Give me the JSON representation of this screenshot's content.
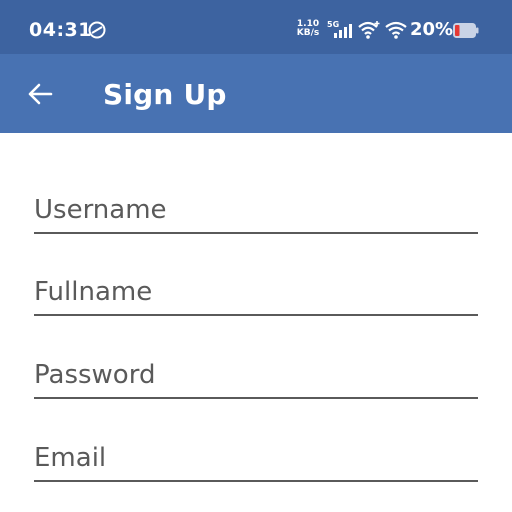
{
  "status_bar": {
    "time": "04:31",
    "net_speed_value": "1.10",
    "net_speed_unit": "KB/s",
    "network_type": "5G",
    "battery_percent": "20%",
    "battery_color": "#e53935"
  },
  "app_bar": {
    "title": "Sign Up",
    "background": "#4872b2"
  },
  "form": {
    "fields": [
      {
        "placeholder": "Username",
        "value": ""
      },
      {
        "placeholder": "Fullname",
        "value": ""
      },
      {
        "placeholder": "Password",
        "value": ""
      },
      {
        "placeholder": "Email",
        "value": ""
      }
    ]
  }
}
